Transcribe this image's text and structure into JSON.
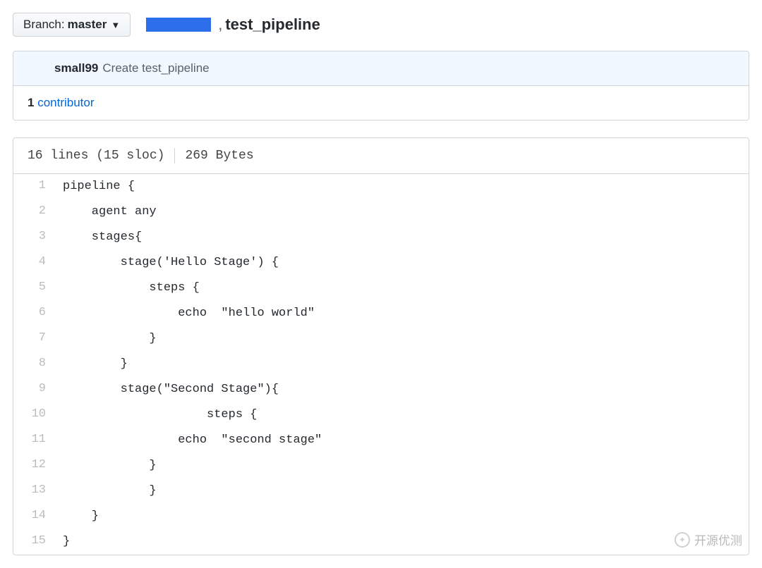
{
  "branch": {
    "label": "Branch:",
    "value": "master"
  },
  "breadcrumb": {
    "separator": ",",
    "file": "test_pipeline"
  },
  "commit": {
    "author": "small99",
    "message": "Create test_pipeline"
  },
  "contributors": {
    "count": "1",
    "label": "contributor"
  },
  "file_stats": {
    "lines_sloc": "16 lines (15 sloc)",
    "bytes": "269 Bytes"
  },
  "code_lines": [
    "pipeline {",
    "    agent any",
    "    stages{",
    "        stage('Hello Stage') {",
    "            steps {",
    "                echo  \"hello world\"",
    "            }",
    "        }",
    "        stage(\"Second Stage\"){",
    "                    steps {",
    "                echo  \"second stage\"",
    "            }",
    "            }",
    "    }",
    "}"
  ],
  "watermark": {
    "text": "开源优测"
  }
}
